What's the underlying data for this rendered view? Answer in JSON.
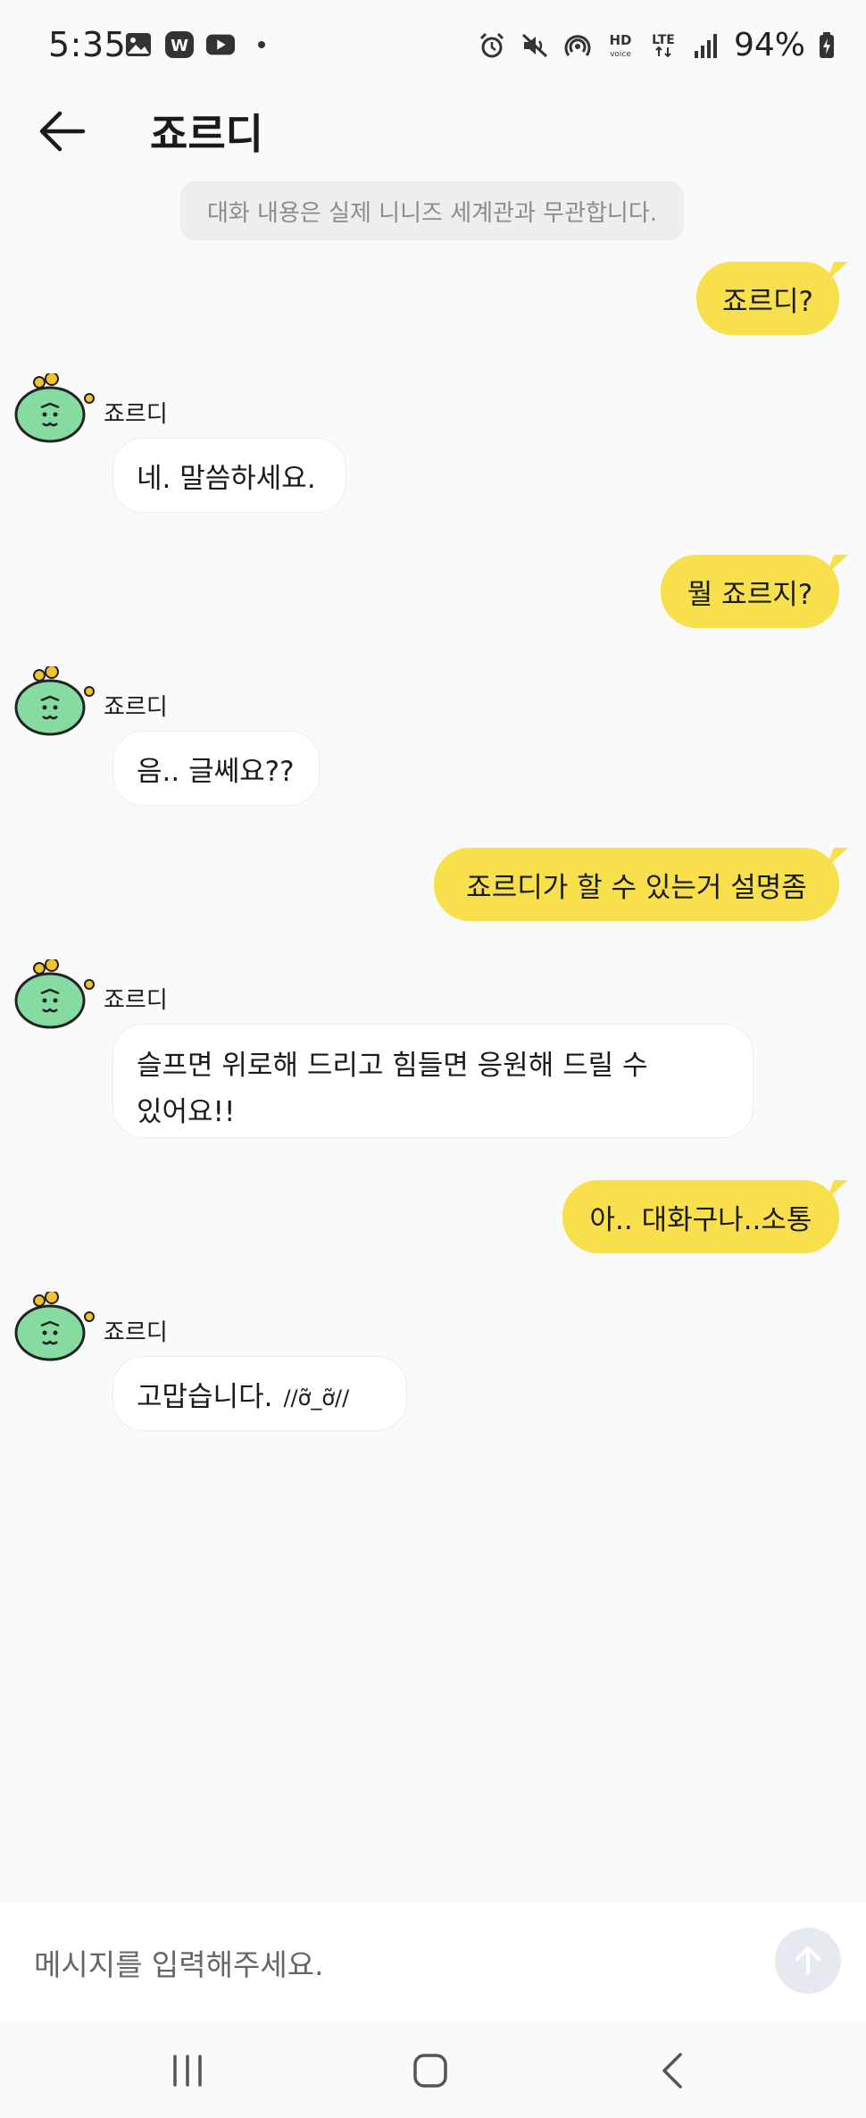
{
  "status_bar": {
    "time": "5:35",
    "battery": "94%",
    "left_icons": [
      "gallery-icon",
      "w-app-icon",
      "youtube-icon",
      "dot-icon"
    ],
    "right_icons": [
      "alarm-icon",
      "mute-icon",
      "hotspot-icon",
      "hd-voice-icon",
      "lte-icon",
      "signal-icon"
    ]
  },
  "header": {
    "title": "죠르디",
    "back_icon": "arrow-left-icon"
  },
  "notice": "대화 내용은 실제 니니즈 세계관과 무관합니다.",
  "bot_name": "죠르디",
  "messages": [
    {
      "from": "user",
      "text": "죠르디?"
    },
    {
      "from": "bot",
      "text": "네. 말씀하세요."
    },
    {
      "from": "user",
      "text": "뭘 죠르지?"
    },
    {
      "from": "bot",
      "text": "음.. 글쎄요??"
    },
    {
      "from": "user",
      "text": "죠르디가 할 수 있는거 설명좀"
    },
    {
      "from": "bot",
      "text_line1": "슬프면 위로해 드리고 힘들면 응원해 드릴 수",
      "text_line2": "있어요!!"
    },
    {
      "from": "user",
      "text": "아.. 대화구나..소통"
    },
    {
      "from": "bot",
      "text": "고맙습니다.",
      "emoticon": "//ỡ_ỡ//"
    }
  ],
  "input": {
    "placeholder": "메시지를 입력해주세요.",
    "send_icon": "arrow-up-icon"
  },
  "colors": {
    "user_bubble": "#f8e04c",
    "bot_bubble": "#ffffff",
    "background": "#fafafa",
    "avatar_green": "#86dba0"
  }
}
